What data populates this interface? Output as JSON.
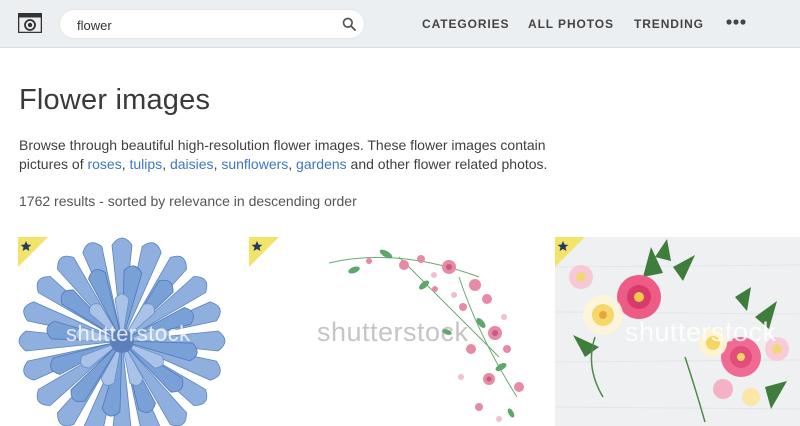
{
  "header": {
    "search_value": "flower",
    "nav": {
      "categories": "CATEGORIES",
      "all_photos": "ALL PHOTOS",
      "trending": "TRENDING"
    }
  },
  "main": {
    "title": "Flower images",
    "description": {
      "intro": "Browse through beautiful high-resolution flower images. These flower images contain pictures of ",
      "links": [
        "roses",
        "tulips",
        "daisies",
        "sunflowers",
        "gardens"
      ],
      "separator": ", ",
      "outro": " and other flower related photos."
    },
    "results_text": "1762 results - sorted by relevance in descending order"
  },
  "thumbnails": [
    {
      "watermark": "shutterstock",
      "badge_icon": "star-icon"
    },
    {
      "watermark": "shutterstock",
      "badge_icon": "star-icon"
    },
    {
      "watermark": "shutterstock",
      "badge_icon": "star-icon"
    }
  ],
  "colors": {
    "link": "#3f76c3",
    "badge": "#f4e36a",
    "topbar": "#eceff1"
  }
}
